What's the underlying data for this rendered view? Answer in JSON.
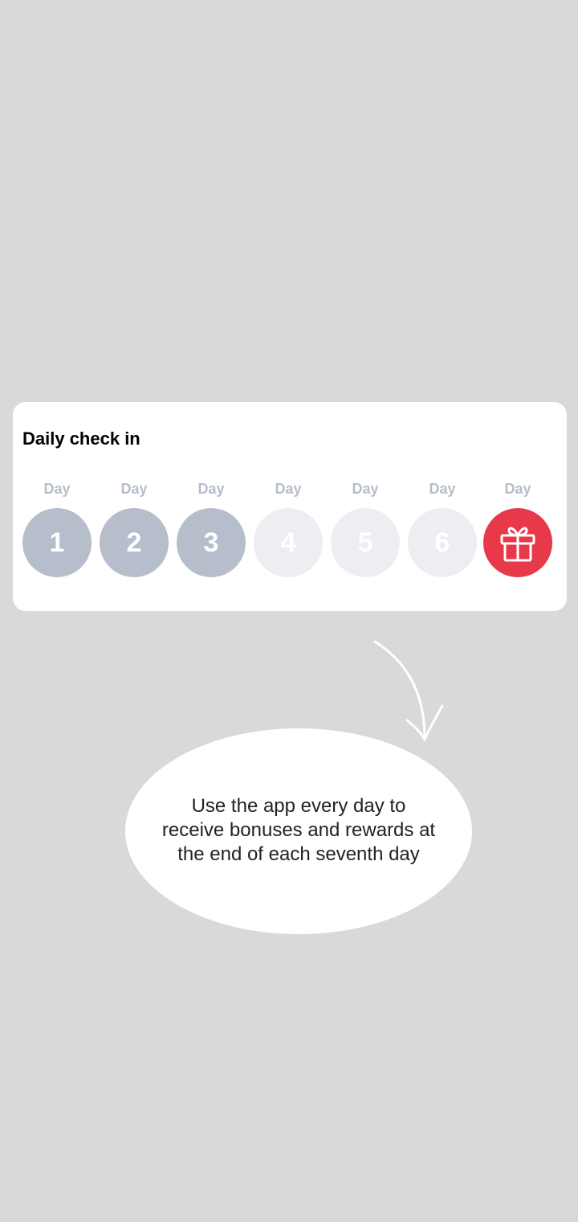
{
  "checkin": {
    "title": "Daily check in",
    "days": [
      {
        "label": "Day",
        "number": "1",
        "status": "done"
      },
      {
        "label": "Day",
        "number": "2",
        "status": "done"
      },
      {
        "label": "Day",
        "number": "3",
        "status": "done"
      },
      {
        "label": "Day",
        "number": "4",
        "status": "pending"
      },
      {
        "label": "Day",
        "number": "5",
        "status": "pending"
      },
      {
        "label": "Day",
        "number": "6",
        "status": "pending"
      },
      {
        "label": "Day",
        "icon": "gift-icon",
        "status": "reward"
      }
    ]
  },
  "hint": {
    "lines": [
      "Use the app every day to",
      "receive bonuses and rewards at",
      "the end of each seventh day"
    ]
  },
  "colors": {
    "background": "#d9d9d9",
    "done": "#b6bdcb",
    "pending": "#eceef2",
    "reward": "#e8394a"
  }
}
